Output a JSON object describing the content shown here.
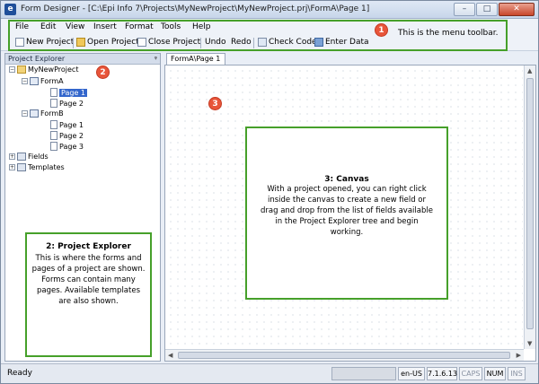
{
  "window": {
    "title": "Form Designer - [C:\\Epi Info 7\\Projects\\MyNewProject\\MyNewProject.prj\\FormA\\Page 1]",
    "app_icon": "e",
    "buttons": {
      "minimize": "–",
      "maximize": "□",
      "close": "✕"
    }
  },
  "menu": [
    "File",
    "Edit",
    "View",
    "Insert",
    "Format",
    "Tools",
    "Help"
  ],
  "toolbar": {
    "new_project": "New Project",
    "open_project": "Open Project",
    "close_project": "Close Project",
    "undo": "Undo",
    "redo": "Redo",
    "check_code": "Check Code",
    "enter_data": "Enter Data"
  },
  "annotations": {
    "badge_1": "1",
    "menu_text": "This is the menu toolbar.",
    "badge_2": "2",
    "badge_3": "3",
    "explorer_title": "2: Project Explorer",
    "explorer_body": "This is where the forms and pages of a project are shown. Forms can contain many pages. Available templates are also shown.",
    "canvas_title": "3: Canvas",
    "canvas_body": "With a project opened, you can right click inside the canvas to create a new field or drag and drop from the list of fields available in the Project Explorer tree and begin working."
  },
  "explorer": {
    "title": "Project Explorer",
    "pin": "ᵠ",
    "tree": {
      "project": "MyNewProject",
      "form_a": "FormA",
      "form_a_pages": [
        "Page 1",
        "Page 2"
      ],
      "form_b": "FormB",
      "form_b_pages": [
        "Page 1",
        "Page 2",
        "Page 3"
      ],
      "fields": "Fields",
      "templates": "Templates"
    },
    "expanders": {
      "open": "−",
      "closed": "+"
    }
  },
  "canvas": {
    "tab": "FormA\\Page 1"
  },
  "status": {
    "text": "Ready",
    "locale": "en-US",
    "version": "7.1.6.13",
    "caps": "CAPS",
    "num": "NUM",
    "ins": "INS"
  },
  "colors": {
    "annotation_green": "#46a02a",
    "badge_red": "#e8553a",
    "selection": "#3366cc"
  }
}
